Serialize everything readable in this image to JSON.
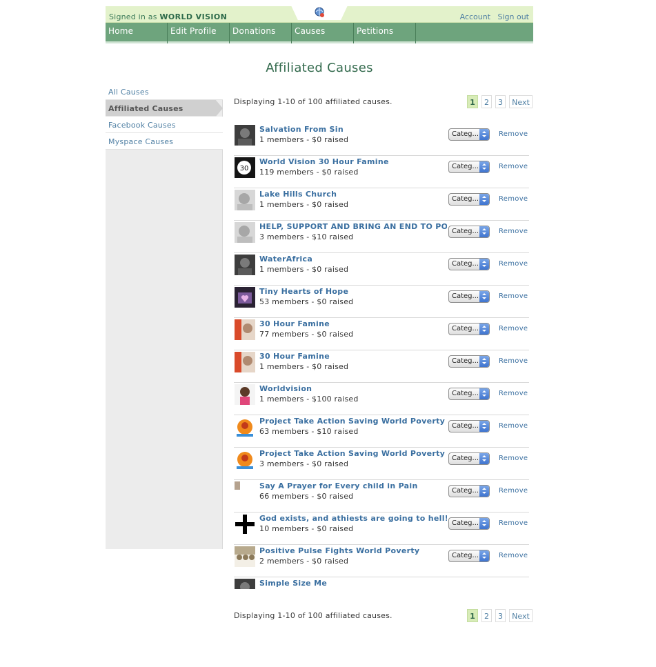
{
  "header": {
    "signed_in_prefix": "Signed in as",
    "signed_in_user": "WORLD VISION",
    "account_label": "Account",
    "signout_label": "Sign out"
  },
  "nav": {
    "items": [
      {
        "label": "Home"
      },
      {
        "label": "Edit Profile"
      },
      {
        "label": "Donations"
      },
      {
        "label": "Causes"
      },
      {
        "label": "Petitions"
      }
    ]
  },
  "page_title": "Affiliated Causes",
  "sidebar": {
    "items": [
      {
        "label": "All Causes"
      },
      {
        "label": "Affiliated Causes",
        "active": true
      },
      {
        "label": "Facebook Causes"
      },
      {
        "label": "Myspace Causes"
      }
    ]
  },
  "summary": "Displaying 1-10 of 100 affiliated causes.",
  "pagination": {
    "pages": [
      "1",
      "2",
      "3"
    ],
    "current": "1",
    "next_label": "Next"
  },
  "row_controls": {
    "category_label": "Categ...",
    "remove_label": "Remove"
  },
  "causes": [
    {
      "title": "Salvation From Sin",
      "meta": "1 members - $0 raised",
      "thumb": "photo-dark"
    },
    {
      "title": "World Vision 30 Hour Famine",
      "meta": "119 members - $0 raised",
      "thumb": "30-badge"
    },
    {
      "title": "Lake Hills Church",
      "meta": "1 members - $0 raised",
      "thumb": "photo-grey"
    },
    {
      "title": "HELP, SUPPORT AND BRING AN END TO POVERTY",
      "meta": "3 members - $10 raised",
      "thumb": "photo-grey"
    },
    {
      "title": "WaterAfrica",
      "meta": "1 members - $0 raised",
      "thumb": "photo-dark"
    },
    {
      "title": "Tiny Hearts of Hope",
      "meta": "53 members - $0 raised",
      "thumb": "photo-purple"
    },
    {
      "title": "30 Hour Famine",
      "meta": "77 members - $0 raised",
      "thumb": "photo-red"
    },
    {
      "title": "30 Hour Famine",
      "meta": "1 members - $0 raised",
      "thumb": "photo-red"
    },
    {
      "title": "Worldvision",
      "meta": "1 members - $100 raised",
      "thumb": "photo-child"
    },
    {
      "title": "Project Take Action Saving World Poverty",
      "meta": "63 members - $10 raised",
      "thumb": "photo-orange"
    },
    {
      "title": "Project Take Action Saving World Poverty",
      "meta": "3 members - $0 raised",
      "thumb": "photo-orange"
    },
    {
      "title": "Say A Prayer for Every child in Pain",
      "meta": "66 members - $0 raised",
      "thumb": "photo-small"
    },
    {
      "title": "God exists, and athiests are going to hell!!!",
      "meta": "10 members - $0 raised",
      "thumb": "cross"
    },
    {
      "title": "Positive Pulse Fights World Poverty",
      "meta": "2 members - $0 raised",
      "thumb": "photo-crowd"
    },
    {
      "title": "Simple Size Me",
      "meta": "",
      "thumb": "photo-dark"
    }
  ]
}
